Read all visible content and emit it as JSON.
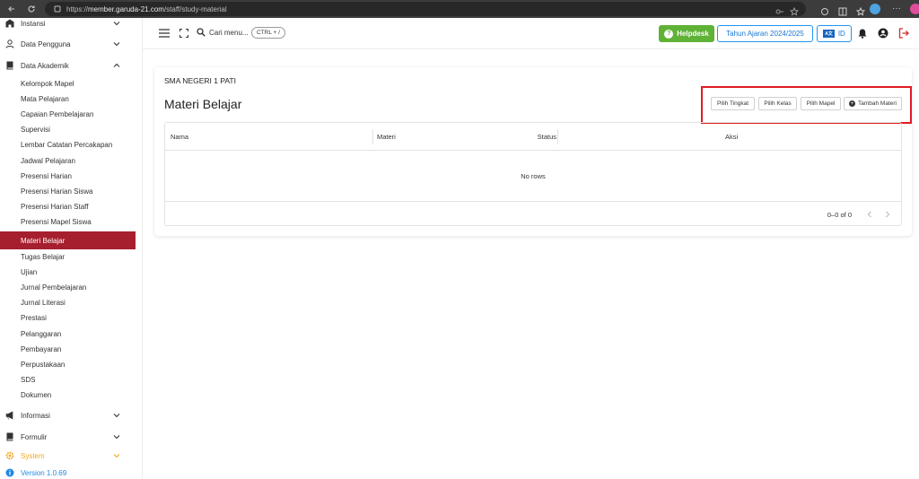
{
  "browser": {
    "url_prefix": "https://",
    "url_domain": "member.garuda-21.com",
    "url_path": "/staff/study-material"
  },
  "sidebar": {
    "groups": {
      "instansi": "Instansi",
      "data_pengguna": "Data Pengguna",
      "data_akademik": "Data Akademik",
      "informasi": "Informasi",
      "formulir": "Formulir",
      "system": "System",
      "version": "Version 1.0.69"
    },
    "items": [
      "Kelompok Mapel",
      "Mata Pelajaran",
      "Capaian Pembelajaran",
      "Supervisi",
      "Lembar Catatan Percakapan",
      "Jadwal Pelajaran",
      "Presensi Harian",
      "Presensi Harian Siswa",
      "Presensi Harian Staff",
      "Presensi Mapel Siswa",
      "Materi Belajar",
      "Tugas Belajar",
      "Ujian",
      "Jurnal Pembelajaran",
      "Jurnal Literasi",
      "Prestasi",
      "Pelanggaran",
      "Pembayaran",
      "Perpustakaan",
      "SDS",
      "Dokumen"
    ],
    "active_item": "Materi Belajar"
  },
  "header": {
    "search_label": "Cari menu...",
    "shortcut": "CTRL + /",
    "helpdesk": "Helpdesk",
    "academic_year": "Tahun Ajaran 2024/2025",
    "lang_flag": "A文",
    "lang": "ID"
  },
  "main": {
    "school": "SMA NEGERI 1 PATI",
    "title": "Materi Belajar",
    "buttons": {
      "pilih_tingkat": "Pilih Tingkat",
      "pilih_kelas": "Pilih Kelas",
      "pilih_mapel": "Pilih Mapel",
      "tambah_materi": "Tambah Materi"
    },
    "table": {
      "columns": [
        "Nama",
        "Materi",
        "Status",
        "Aksi"
      ],
      "empty": "No rows",
      "pagination": "0–0 of 0"
    }
  },
  "colors": {
    "active": "#a61f2e",
    "helpdesk": "#5fb236",
    "primary": "#1976d2",
    "highlight": "#e01b24",
    "system": "#f5a623"
  }
}
